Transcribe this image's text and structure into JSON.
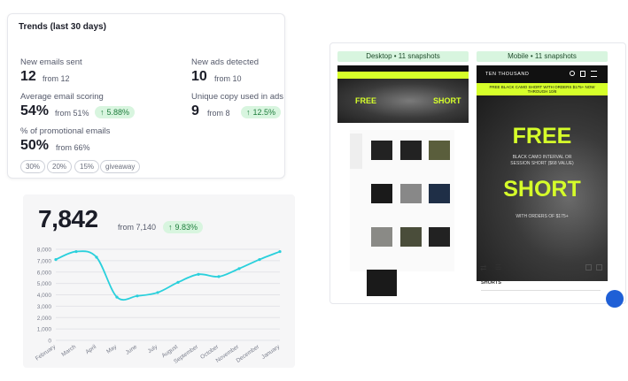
{
  "trends": {
    "title": "Trends (last 30 days)",
    "new_emails": {
      "label": "New emails sent",
      "value": "12",
      "from": "from 12"
    },
    "new_ads": {
      "label": "New ads detected",
      "value": "10",
      "from": "from 10"
    },
    "avg_scoring": {
      "label": "Average email scoring",
      "value": "54%",
      "from": "from 51%",
      "change": "5.88%"
    },
    "unique_copy": {
      "label": "Unique copy used in ads",
      "value": "9",
      "from": "from 8",
      "change": "12.5%"
    },
    "promo": {
      "label": "% of promotional emails",
      "value": "50%",
      "from": "from 66%"
    },
    "tags": [
      "30%",
      "20%",
      "15%",
      "giveaway"
    ]
  },
  "chart_card": {
    "value": "7,842",
    "from": "from 7,140",
    "change": "9.83%"
  },
  "chart_data": {
    "type": "line",
    "categories": [
      "February",
      "March",
      "April",
      "May",
      "June",
      "July",
      "August",
      "September",
      "October",
      "November",
      "December",
      "January"
    ],
    "values": [
      7100,
      7800,
      7300,
      3800,
      3900,
      4200,
      5100,
      5800,
      5600,
      6300,
      7100,
      7800
    ],
    "ylim": [
      0,
      8000
    ],
    "yticks": [
      "8,000",
      "7,000",
      "6,000",
      "5,000",
      "4,000",
      "3,000",
      "2,000",
      "1,000",
      "0"
    ],
    "color": "#2ad0dc",
    "grid": true
  },
  "snapshots": {
    "desktop_label": "Desktop • 11 snapshots",
    "mobile_label": "Mobile • 11 snapshots",
    "brand": "TEN THOUSAND",
    "promo_banner": "FREE BLACK CAMO SHORT WITH ORDERS $175+ NOW THROUGH 10/8",
    "hero_word1": "FREE",
    "hero_line": "BLACK CAMO INTERVAL OR SESSION SHORT ($68 VALUE)",
    "hero_word2": "SHORT",
    "hero_sub": "WITH ORDERS OF $175+",
    "section": "SHORTS",
    "accent": "#d6ff2a"
  }
}
